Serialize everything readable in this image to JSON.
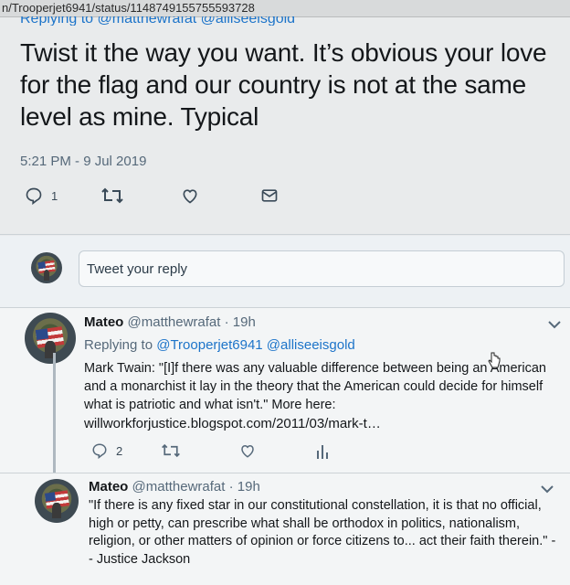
{
  "url": "n/Trooperjet6941/status/1148749155755593728",
  "main_tweet": {
    "replying_label": "Replying to @matthewrafat @alliseeisgold",
    "text": "Twist it the way you want. It’s obvious your love for the flag and our country is not at the same level as mine. Typical",
    "timestamp": "5:21 PM - 9 Jul 2019",
    "reply_count": "1"
  },
  "composer": {
    "placeholder": "Tweet your reply"
  },
  "reply1": {
    "name": "Mateo",
    "handle": "@matthewrafat",
    "dot": "·",
    "age": "19h",
    "replying_prefix": "Replying to",
    "replying_to_1": "@Trooperjet6941",
    "replying_to_2": "@alliseeisgold",
    "text": "Mark Twain: \"[I]f there was any valuable difference between being an American and a monarchist it lay in the theory that the American could decide for himself what is patriotic and what isn't.\" More here:",
    "link": "willworkforjustice.blogspot.com/2011/03/mark-t…",
    "reply_count": "2"
  },
  "reply2": {
    "name": "Mateo",
    "handle": "@matthewrafat",
    "dot": "·",
    "age": "19h",
    "text": "\"If there is any fixed star in our constitutional constellation, it is that no official, high or petty, can prescribe what shall be orthodox in politics, nationalism, religion, or other matters of opinion or force citizens to... act their faith therein.\" -- Justice Jackson"
  },
  "icons": [
    "reply-icon",
    "retweet-icon",
    "like-icon",
    "message-icon",
    "analytics-icon",
    "chevron-down-icon"
  ],
  "colors": {
    "link": "#1d74c9",
    "text": "#14171a",
    "muted": "#56697a"
  }
}
